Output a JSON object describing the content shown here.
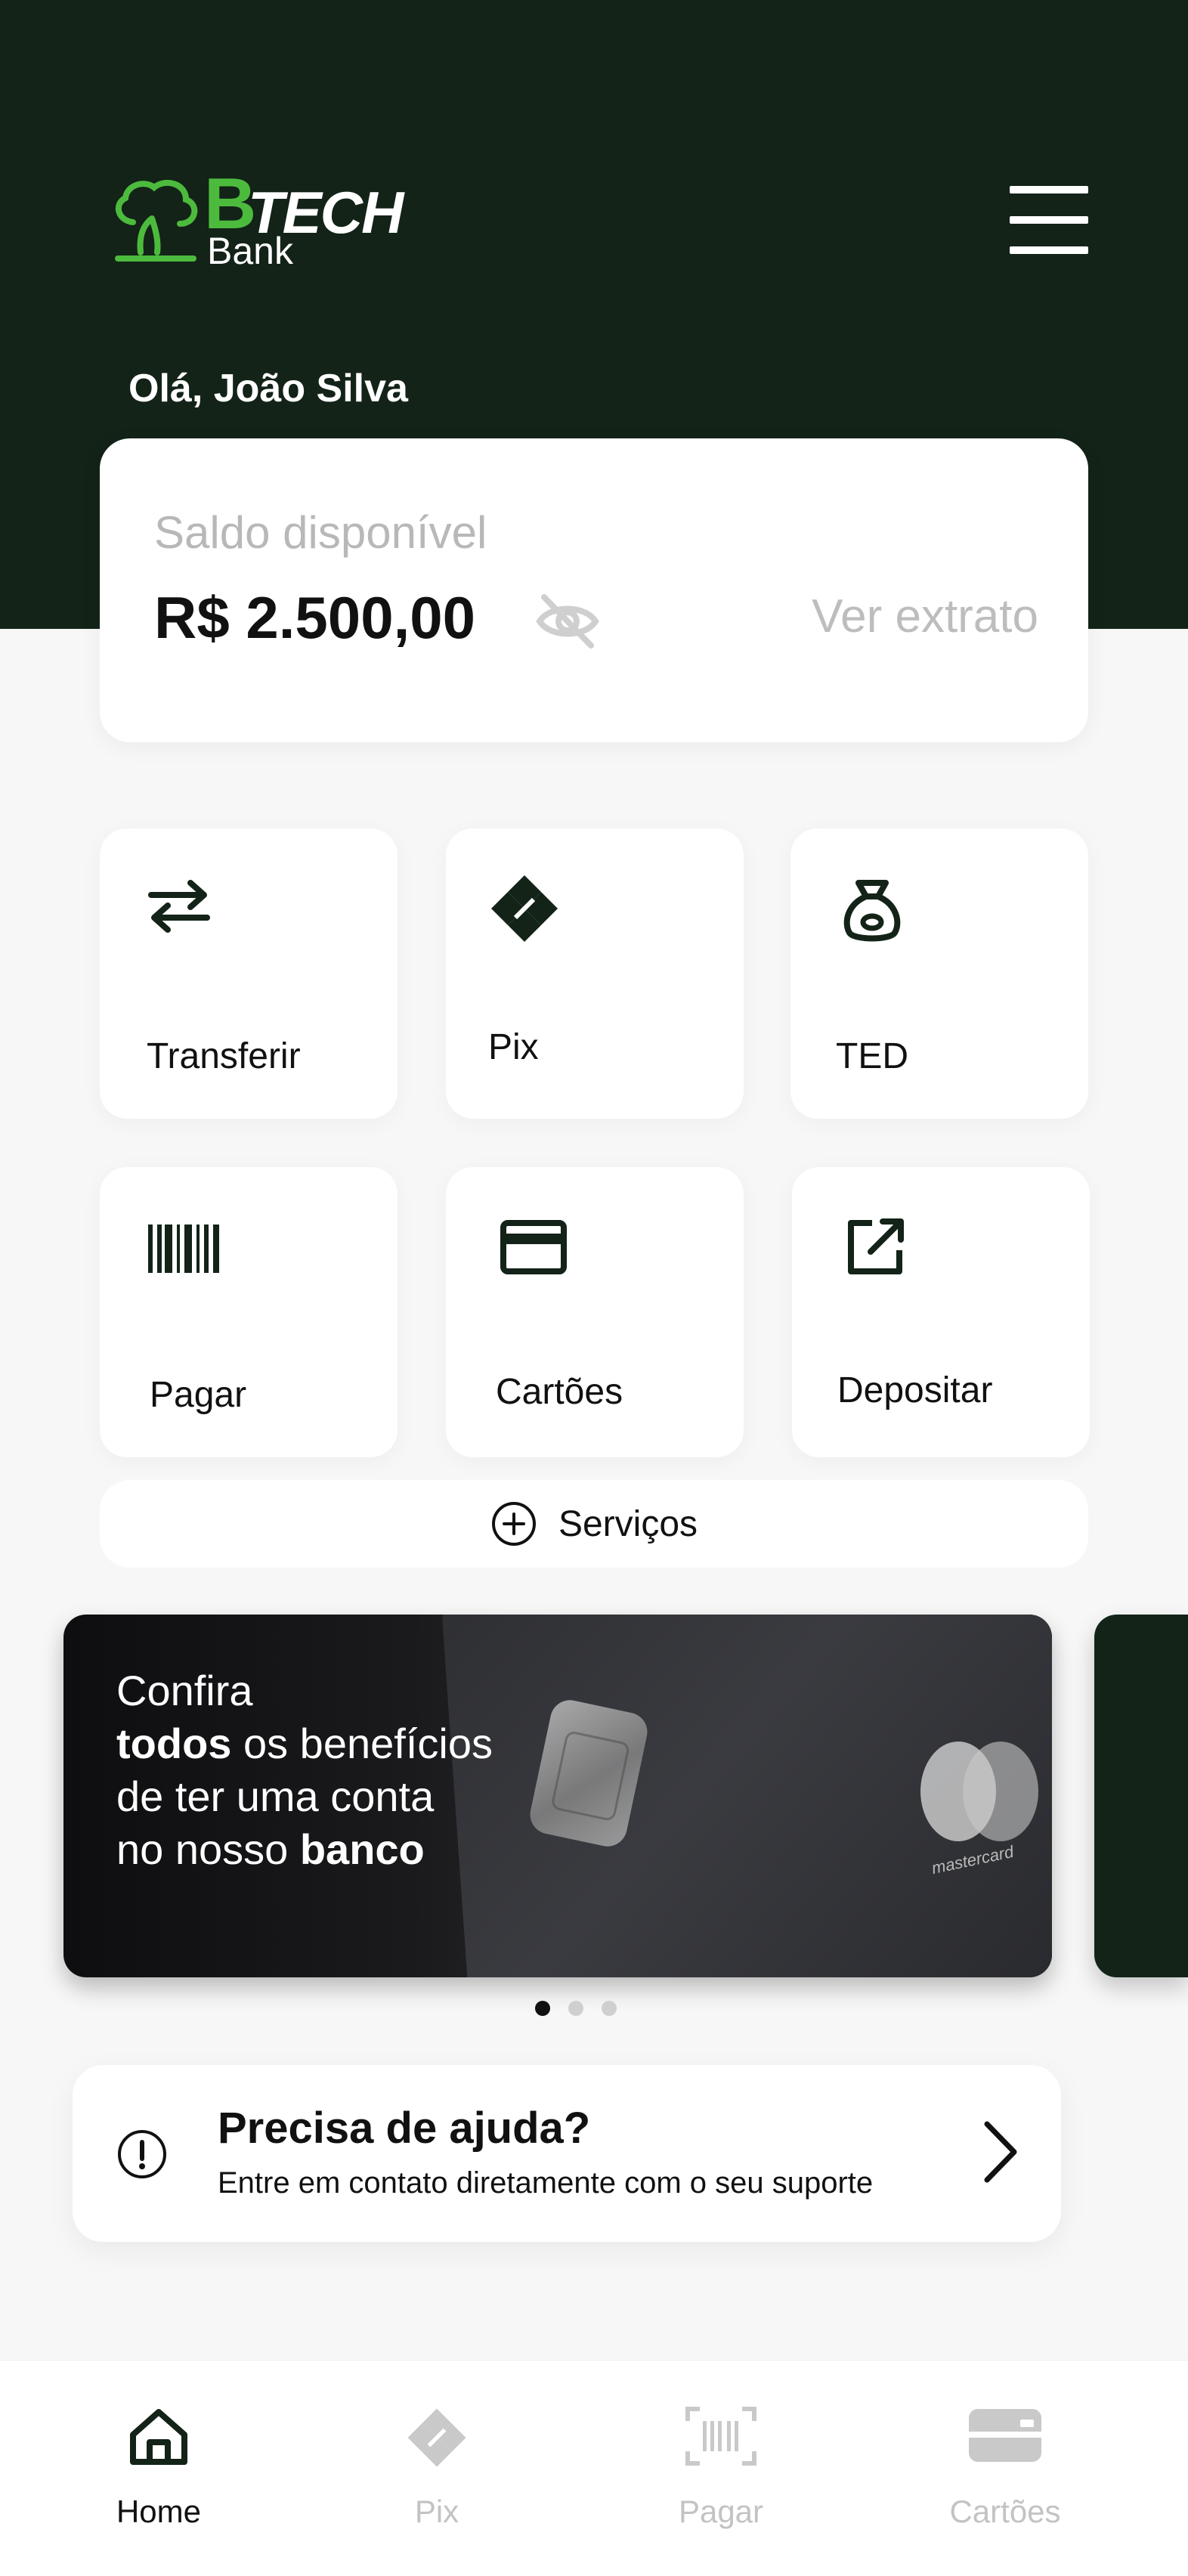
{
  "header": {
    "logo_b": "B",
    "logo_tech": "TECH",
    "logo_bank": "Bank",
    "greeting": "Olá, João Silva"
  },
  "balance": {
    "label": "Saldo disponível",
    "value": "R$ 2.500,00",
    "statement_link": "Ver extrato"
  },
  "actions": [
    {
      "label": "Transferir",
      "icon": "transfer-arrows-icon"
    },
    {
      "label": "Pix",
      "icon": "pix-icon"
    },
    {
      "label": "TED",
      "icon": "money-bag-icon"
    },
    {
      "label": "Pagar",
      "icon": "barcode-icon"
    },
    {
      "label": "Cartões",
      "icon": "credit-card-icon"
    },
    {
      "label": "Depositar",
      "icon": "external-link-icon"
    }
  ],
  "services": {
    "label": "Serviços",
    "icon": "plus-circle-icon"
  },
  "banner": {
    "line1": "Confira",
    "line2_bold": "todos",
    "line2_rest": " os benefícios",
    "line3": "de ter uma conta",
    "line4_prefix": "no nosso ",
    "line4_bold": "banco",
    "card_brand": "mastercard",
    "pages": 3,
    "active_page": 1
  },
  "help": {
    "title": "Precisa de ajuda?",
    "subtitle": "Entre em contato diretamente com o seu suporte"
  },
  "bottom_nav": [
    {
      "label": "Home",
      "icon": "home-icon",
      "active": true
    },
    {
      "label": "Pix",
      "icon": "pix-icon",
      "active": false
    },
    {
      "label": "Pagar",
      "icon": "barcode-scan-icon",
      "active": false
    },
    {
      "label": "Cartões",
      "icon": "card-icon",
      "active": false
    }
  ],
  "colors": {
    "brand_dark": "#132318",
    "brand_green": "#4cbb3d",
    "background": "#f7f7f7"
  }
}
